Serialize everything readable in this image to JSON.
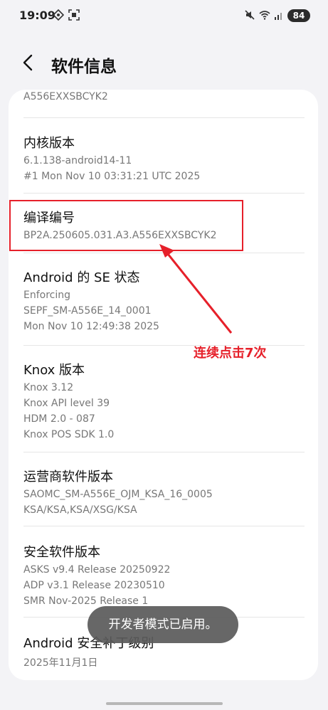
{
  "status_bar": {
    "time": "19:09",
    "battery": "84",
    "icons": [
      "vpn-icon",
      "screenshot-icon",
      "mute-icon",
      "wifi-icon",
      "signal-icon",
      "battery-icon"
    ]
  },
  "header": {
    "title": "软件信息",
    "back_icon": "chevron-left-icon"
  },
  "items": [
    {
      "title": "",
      "lines": [
        "A556EXXSBCYK2"
      ]
    },
    {
      "title": "内核版本",
      "lines": [
        "6.1.138-android14-11",
        "#1 Mon Nov 10 03:31:21 UTC 2025"
      ]
    },
    {
      "title": "编译编号",
      "lines": [
        "BP2A.250605.031.A3.A556EXXSBCYK2"
      ]
    },
    {
      "title": "Android 的 SE 状态",
      "lines": [
        "Enforcing",
        "SEPF_SM-A556E_14_0001",
        "Mon Nov 10 12:49:38 2025"
      ]
    },
    {
      "title": "Knox 版本",
      "lines": [
        "Knox 3.12",
        "Knox API level 39",
        "HDM 2.0 - 087",
        "Knox POS SDK 1.0"
      ]
    },
    {
      "title": "运营商软件版本",
      "lines": [
        "SAOMC_SM-A556E_OJM_KSA_16_0005",
        "KSA/KSA,KSA/XSG/KSA"
      ]
    },
    {
      "title": "安全软件版本",
      "lines": [
        "ASKS v9.4  Release 20250922",
        "ADP v3.1 Release 20230510",
        "SMR Nov-2025 Release 1"
      ]
    },
    {
      "title": "Android 安全补丁级别",
      "lines": [
        "2025年11月1日"
      ]
    }
  ],
  "annotation": {
    "text": "连续点击7次",
    "color": "#e6202a"
  },
  "toast": {
    "text": "开发者模式已启用。"
  }
}
